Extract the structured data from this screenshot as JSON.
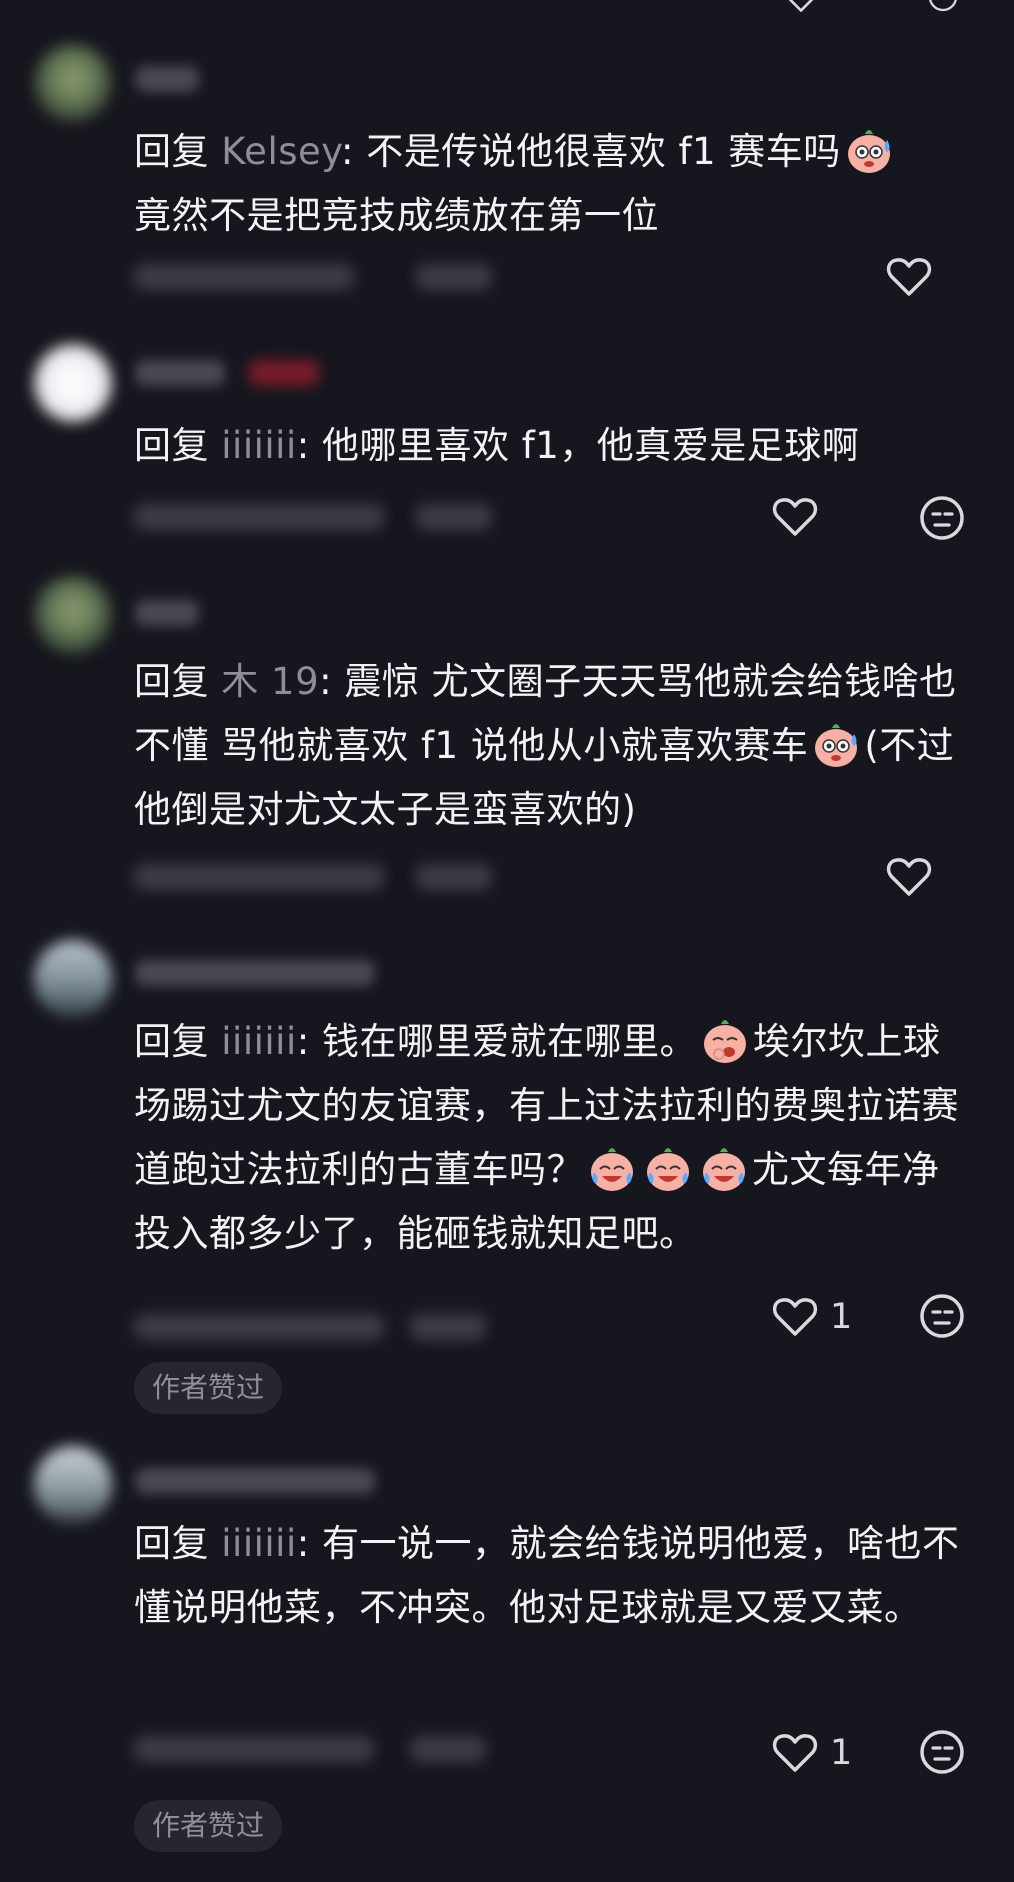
{
  "comments": [
    {
      "avatar": "green-figure",
      "reply_word": "回复",
      "reply_to": "Kelsey",
      "colon": ":",
      "text_parts": [
        " 不是传说他很喜欢 f1 赛车吗",
        " 竟然不是把竞技成绩放在第一位"
      ],
      "emoji_after_part": [
        true,
        false
      ],
      "emoji_name": "sweating-face-emoji",
      "likes": "",
      "author_liked": false
    },
    {
      "avatar": "white-circle",
      "reply_word": "回复",
      "reply_to": "iiiiiii",
      "colon": ":",
      "text_parts": [
        " 他哪里喜欢 f1，他真爱是足球啊"
      ],
      "likes": "",
      "author_liked": false
    },
    {
      "avatar": "green-figure",
      "reply_word": "回复",
      "reply_to": "木 19",
      "colon": ":",
      "text_parts": [
        " 震惊 尤文圈子天天骂他就会给钱啥也不懂 骂他就喜欢 f1 说他从小就喜欢赛车",
        "(不过他倒是对尤文太子是蛮喜欢的)"
      ],
      "emoji_name": "sweating-face-emoji",
      "likes": "",
      "author_liked": false
    },
    {
      "avatar": "scenery",
      "reply_word": "回复",
      "reply_to": "iiiiiii",
      "colon": ":",
      "text_parts": [
        " 钱在哪里爱就在哪里。",
        "埃尔坎上球场踢过尤文的友谊赛，有上过法拉利的费奥拉诺赛道跑过法拉利的古董车吗？",
        "尤文每年净投入都多少了，能砸钱就知足吧。"
      ],
      "emoji_names": [
        "thinking-face-emoji",
        "laughing-crying-face-emoji"
      ],
      "likes": "1",
      "author_liked": true,
      "author_badge": "作者赞过"
    },
    {
      "avatar": "scenery",
      "reply_word": "回复",
      "reply_to": "iiiiiii",
      "colon": ":",
      "text_parts": [
        " 有一说一，就会给钱说明他爱，啥也不懂说明他菜，不冲突。他对足球就是又爱又菜。"
      ],
      "likes": "1",
      "author_liked": true,
      "author_badge": "作者赞过"
    }
  ],
  "colors": {
    "background": "#16161e",
    "text": "#f3f3f5",
    "username": "#8e8e96",
    "badge_bg": "#26262e"
  },
  "icons": [
    "heart-icon",
    "dislike-face-icon"
  ]
}
